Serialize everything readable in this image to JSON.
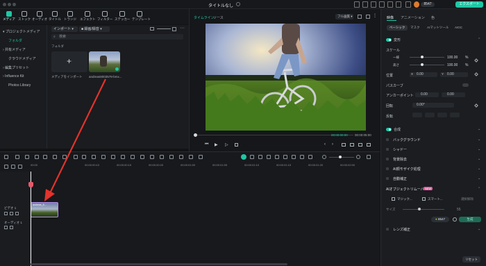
{
  "window": {
    "title": "タイトルなし"
  },
  "topbar": {
    "credits": "8547",
    "export_label": "エクスポート"
  },
  "toolbar": {
    "items": [
      {
        "label": "メディア",
        "active": true
      },
      {
        "label": "ストック"
      },
      {
        "label": "オーディオ"
      },
      {
        "label": "タイトル"
      },
      {
        "label": "トランジ"
      },
      {
        "label": "エフェクト"
      },
      {
        "label": "フィルター"
      },
      {
        "label": "ステッカー"
      },
      {
        "label": "テンプレート"
      }
    ]
  },
  "sidebar": {
    "items": [
      {
        "label": "▾ プロジェクトメディア"
      },
      {
        "label": "フォルダ",
        "selected": true
      },
      {
        "label": "› 共有メディア"
      },
      {
        "label": "クラウドメディア"
      },
      {
        "label": "› 編集プリセット"
      },
      {
        "label": "› Influence Kit"
      },
      {
        "label": "Photos Library"
      }
    ]
  },
  "media": {
    "import_button": "インポート",
    "sort_dropdown": "録画/録音",
    "search_placeholder": "検索",
    "folder_label": "フォルダ",
    "import_tile_label": "メディアをインポート",
    "clip_name": "andreas8003578-bmx..."
  },
  "preview": {
    "tab_timeline": "タイムライン",
    "tab_source": "ソース",
    "quality": "フル画質",
    "time_current": "00:00:00:00",
    "time_total": "00:00:05:00"
  },
  "timeline": {
    "track_video": "ビデオ 1",
    "track_audio": "オーディオ 1",
    "clip_label": "andreas_8...",
    "ruler": [
      "00:00",
      "00:00:00:10",
      "00:00:00:15",
      "00:00:00:20",
      "00:00:01:00",
      "00:00:01:05",
      "00:00:01:10",
      "00:00:01:15",
      "00:00:01:20",
      "00:00:02:00"
    ]
  },
  "properties": {
    "tabs": [
      "映像",
      "アニメーション",
      "色"
    ],
    "subtabs": [
      "ベーシック",
      "マスク",
      "AIマットツール",
      "AIGC"
    ],
    "transform_label": "変形",
    "scale_label": "スケール",
    "uniform_label": "一様",
    "scale_x": "100.00",
    "scale_y": "100.00",
    "scale_unit": "%",
    "position_label": "位置",
    "position_x_axis": "X",
    "position_x": "0.00",
    "position_y_axis": "Y",
    "position_y": "0.00",
    "path_curve_label": "パスカーブ",
    "anchor_label": "アンカーポイント",
    "anchor_x": "0.00",
    "anchor_y": "0.00",
    "rotation_label": "回転",
    "rotation_value": "0.00°",
    "flip_label": "反転",
    "composite_label": "合成",
    "sections": [
      "バックグラウンド",
      "シャドー",
      "背景除去",
      "AI顔モザイク処理",
      "自動補正"
    ],
    "ai_remover_label": "AIオブジェクトリムーバー",
    "ai_badge": "NEW",
    "magic_label": "マジック...",
    "smart_label": "スマート...",
    "deselect_label": "選択解除",
    "size_label": "サイズ",
    "size_value": "55",
    "credit_badge": "8547",
    "apply_label": "生成",
    "lens_label": "レンズ補正",
    "reset_label": "リセット"
  },
  "colors": {
    "accent": "#1ec7a5",
    "badge": "#e05aa0",
    "arrow": "#e5322b"
  }
}
